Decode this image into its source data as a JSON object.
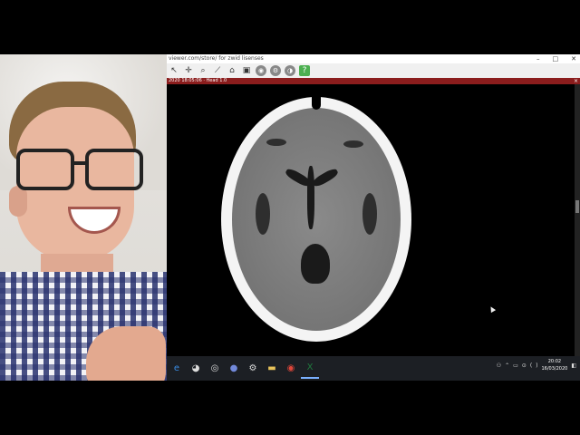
{
  "viewer": {
    "title_url": "viewer.com/store/ for zwid lisenses",
    "window_controls": {
      "minimize": "–",
      "maximize": "□",
      "close": "✕"
    },
    "toolbar_icons": [
      "arrow-cursor-icon",
      "crosshair-icon",
      "zoom-icon",
      "ruler-icon",
      "spine-label-icon",
      "screen-capture-icon",
      "3d-icon",
      "settings-icon",
      "contrast-icon",
      "help-icon"
    ],
    "info_text": "2020 18:05:06 · Head 1.0",
    "info_close": "×"
  },
  "taskbar": {
    "icons": [
      "edge-icon",
      "steam-icon",
      "obs-icon",
      "discord-icon",
      "settings-icon",
      "explorer-icon",
      "chrome-icon",
      "excel-icon"
    ],
    "tray_glyphs": [
      "⌃",
      "▭",
      "⊙",
      "(",
      ")",
      "◧"
    ],
    "clock": {
      "time": "20:02",
      "date": "16/03/2020"
    }
  },
  "colors": {
    "info_bar": "#8b1d1d",
    "taskbar": "#1c1f24",
    "shirt_check": "#28326e"
  }
}
